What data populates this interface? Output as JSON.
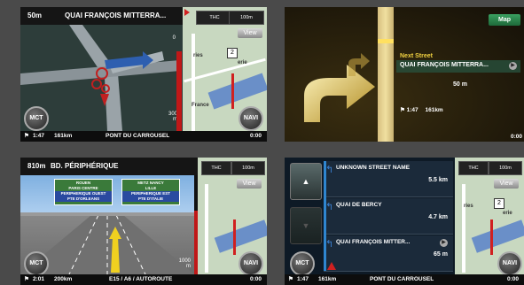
{
  "panel1": {
    "top": {
      "distance": "50m",
      "street": "QUAI FRANÇOIS MITTERRA..."
    },
    "compass": "THC",
    "scale": "100m",
    "view": "View",
    "route_num": "2",
    "map_labels": [
      "ries",
      "erie",
      "France"
    ],
    "left_dist": "0",
    "bottom_dist": "300\nm",
    "mct": "MCT",
    "navi": "NAVI",
    "bottom": {
      "time": "1:47",
      "distance": "161km",
      "street": "PONT DU CARROUSEL",
      "clock": "0:00"
    }
  },
  "panel2": {
    "map_button": "Map",
    "next_label": "Next Street",
    "next_street": "QUAI FRANÇOIS MITTERRA...",
    "next_distance": "50 m",
    "bottom": {
      "time": "1:47",
      "distance": "161km",
      "clock": "0:00"
    }
  },
  "panel3": {
    "top": {
      "distance": "810m",
      "street": "BD. PÉRIPHÉRIQUE"
    },
    "signs": [
      {
        "lines": [
          "ROUEN",
          "PARIS CENTRE",
          "PERIPHERIQUE OUEST",
          "PTE D'ORLEANS"
        ]
      },
      {
        "lines": [
          "METZ NANCY",
          "LILLE",
          "PERIPHERIQUE EST",
          "PTE D'ITALIE"
        ]
      }
    ],
    "compass": "THC",
    "scale": "100m",
    "view": "View",
    "right_dist": "1000\nm",
    "mct": "MCT",
    "navi": "NAVI",
    "bottom": {
      "time": "2:01",
      "distance": "200km",
      "street": "E15 / A6 / AUTOROUTE",
      "clock": "0:00"
    }
  },
  "panel4": {
    "rows": [
      {
        "name": "UNKNOWN STREET NAME",
        "distance": "5.5 km"
      },
      {
        "name": "QUAI DE BERCY",
        "distance": "4.7 km"
      },
      {
        "name": "QUAI FRANÇOIS MITTER...",
        "distance": "65 m"
      }
    ],
    "compass": "THC",
    "scale": "100m",
    "view": "View",
    "route_num": "2",
    "map_labels": [
      "ries",
      "erie"
    ],
    "mct": "MCT",
    "navi": "NAVI",
    "bottom": {
      "time": "1:47",
      "distance": "161km",
      "street": "PONT DU CARROUSEL",
      "clock": "0:00"
    }
  }
}
